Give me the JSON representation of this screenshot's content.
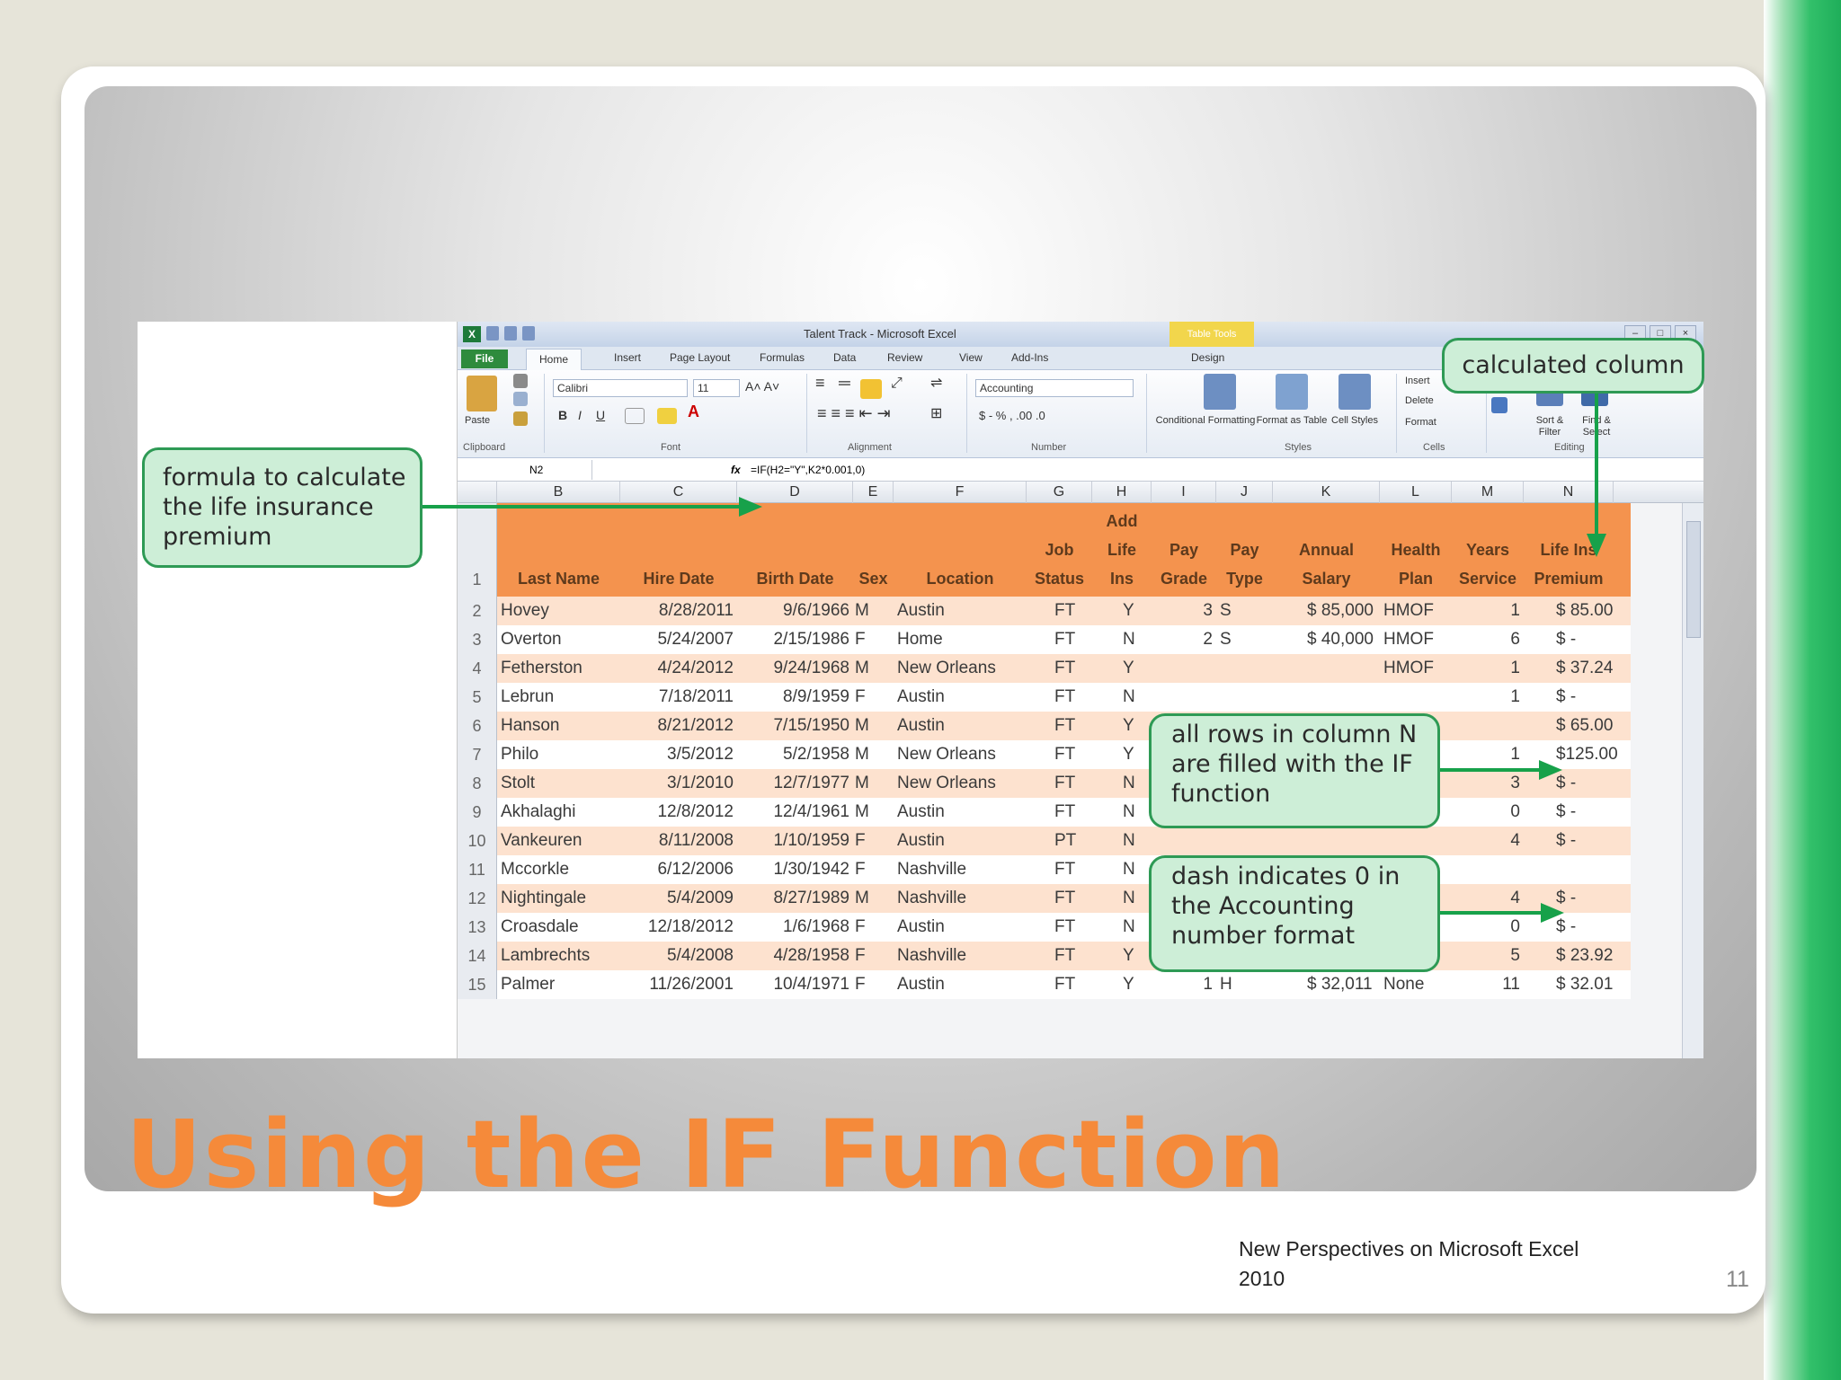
{
  "slide": {
    "title": "Using the IF Function",
    "footer": "New Perspectives on Microsoft Excel 2010",
    "page_number": "11"
  },
  "excel": {
    "window_title": "Talent Track - Microsoft Excel",
    "context_tab_header": "Table Tools",
    "tabs": [
      "File",
      "Home",
      "Insert",
      "Page Layout",
      "Formulas",
      "Data",
      "Review",
      "View",
      "Add-Ins",
      "Design"
    ],
    "ribbon": {
      "paste_label": "Paste",
      "font_name": "Calibri",
      "font_size": "11",
      "number_format": "Accounting",
      "conditional_formatting": "Conditional Formatting",
      "format_as_table": "Format as Table",
      "cell_styles": "Cell Styles",
      "insert": "Insert",
      "delete": "Delete",
      "format": "Format",
      "sort_filter": "Sort & Filter",
      "find_select": "Find & Select",
      "group_labels": [
        "Clipboard",
        "Font",
        "Alignment",
        "Number",
        "Styles",
        "Cells",
        "Editing"
      ]
    },
    "name_box": "N2",
    "fx_label": "fx",
    "formula": "=IF(H2=\"Y\",K2*0.001,0)",
    "column_letters": [
      "B",
      "C",
      "D",
      "E",
      "F",
      "G",
      "H",
      "I",
      "J",
      "K",
      "L",
      "M",
      "N"
    ],
    "header_row": {
      "row_number": "1",
      "cells": [
        {
          "top": "",
          "mid": "",
          "bottom": "Last Name"
        },
        {
          "top": "",
          "mid": "",
          "bottom": "Hire Date"
        },
        {
          "top": "",
          "mid": "",
          "bottom": "Birth Date"
        },
        {
          "top": "",
          "mid": "",
          "bottom": "Sex"
        },
        {
          "top": "",
          "mid": "",
          "bottom": "Location"
        },
        {
          "top": "",
          "mid": "Job",
          "bottom": "Status"
        },
        {
          "top": "Add",
          "mid": "Life",
          "bottom": "Ins"
        },
        {
          "top": "",
          "mid": "Pay",
          "bottom": "Grade"
        },
        {
          "top": "",
          "mid": "Pay",
          "bottom": "Type"
        },
        {
          "top": "",
          "mid": "Annual",
          "bottom": "Salary"
        },
        {
          "top": "",
          "mid": "Health",
          "bottom": "Plan"
        },
        {
          "top": "",
          "mid": "Years",
          "bottom": "Service"
        },
        {
          "top": "",
          "mid": "Life Ins",
          "bottom": "Premium"
        }
      ]
    },
    "rows": [
      {
        "n": "2",
        "name": "Hovey",
        "hire": "8/28/2011",
        "birth": "9/6/1966",
        "sex": "M",
        "loc": "Austin",
        "status": "FT",
        "ins": "Y",
        "grade": "3",
        "type": "S",
        "salary": "$  85,000",
        "plan": "HMOF",
        "years": "1",
        "premium": "$  85.00"
      },
      {
        "n": "3",
        "name": "Overton",
        "hire": "5/24/2007",
        "birth": "2/15/1986",
        "sex": "F",
        "loc": "Home",
        "status": "FT",
        "ins": "N",
        "grade": "2",
        "type": "S",
        "salary": "$  40,000",
        "plan": "HMOF",
        "years": "6",
        "premium": "$     -"
      },
      {
        "n": "4",
        "name": "Fetherston",
        "hire": "4/24/2012",
        "birth": "9/24/1968",
        "sex": "M",
        "loc": "New Orleans",
        "status": "FT",
        "ins": "Y",
        "grade": "",
        "type": "",
        "salary": "",
        "plan": "HMOF",
        "years": "1",
        "premium": "$  37.24"
      },
      {
        "n": "5",
        "name": "Lebrun",
        "hire": "7/18/2011",
        "birth": "8/9/1959",
        "sex": "F",
        "loc": "Austin",
        "status": "FT",
        "ins": "N",
        "grade": "",
        "type": "",
        "salary": "",
        "plan": "",
        "years": "1",
        "premium": "$     -"
      },
      {
        "n": "6",
        "name": "Hanson",
        "hire": "8/21/2012",
        "birth": "7/15/1950",
        "sex": "M",
        "loc": "Austin",
        "status": "FT",
        "ins": "Y",
        "grade": "",
        "type": "",
        "salary": "",
        "plan": "",
        "years": "",
        "premium": "$  65.00"
      },
      {
        "n": "7",
        "name": "Philo",
        "hire": "3/5/2012",
        "birth": "5/2/1958",
        "sex": "M",
        "loc": "New Orleans",
        "status": "FT",
        "ins": "Y",
        "grade": "",
        "type": "",
        "salary": "",
        "plan": "",
        "years": "1",
        "premium": "$125.00"
      },
      {
        "n": "8",
        "name": "Stolt",
        "hire": "3/1/2010",
        "birth": "12/7/1977",
        "sex": "M",
        "loc": "New Orleans",
        "status": "FT",
        "ins": "N",
        "grade": "",
        "type": "",
        "salary": "",
        "plan": "",
        "years": "3",
        "premium": "$     -"
      },
      {
        "n": "9",
        "name": "Akhalaghi",
        "hire": "12/8/2012",
        "birth": "12/4/1961",
        "sex": "M",
        "loc": "Austin",
        "status": "FT",
        "ins": "N",
        "grade": "",
        "type": "",
        "salary": "",
        "plan": "",
        "years": "0",
        "premium": "$     -"
      },
      {
        "n": "10",
        "name": "Vankeuren",
        "hire": "8/11/2008",
        "birth": "1/10/1959",
        "sex": "F",
        "loc": "Austin",
        "status": "PT",
        "ins": "N",
        "grade": "",
        "type": "",
        "salary": "",
        "plan": "",
        "years": "4",
        "premium": "$     -"
      },
      {
        "n": "11",
        "name": "Mccorkle",
        "hire": "6/12/2006",
        "birth": "1/30/1942",
        "sex": "F",
        "loc": "Nashville",
        "status": "FT",
        "ins": "N",
        "grade": "",
        "type": "",
        "salary": "",
        "plan": "",
        "years": "",
        "premium": ""
      },
      {
        "n": "12",
        "name": "Nightingale",
        "hire": "5/4/2009",
        "birth": "8/27/1989",
        "sex": "M",
        "loc": "Nashville",
        "status": "FT",
        "ins": "N",
        "grade": "",
        "type": "",
        "salary": "",
        "plan": "",
        "years": "4",
        "premium": "$     -"
      },
      {
        "n": "13",
        "name": "Croasdale",
        "hire": "12/18/2012",
        "birth": "1/6/1968",
        "sex": "F",
        "loc": "Austin",
        "status": "FT",
        "ins": "N",
        "grade": "",
        "type": "",
        "salary": "",
        "plan": "",
        "years": "0",
        "premium": "$     -"
      },
      {
        "n": "14",
        "name": "Lambrechts",
        "hire": "5/4/2008",
        "birth": "4/28/1958",
        "sex": "F",
        "loc": "Nashville",
        "status": "FT",
        "ins": "Y",
        "grade": "1",
        "type": "H",
        "salary": "$  23,920",
        "plan": "HMOF",
        "years": "5",
        "premium": "$  23.92"
      },
      {
        "n": "15",
        "name": "Palmer",
        "hire": "11/26/2001",
        "birth": "10/4/1971",
        "sex": "F",
        "loc": "Austin",
        "status": "FT",
        "ins": "Y",
        "grade": "1",
        "type": "H",
        "salary": "$  32,011",
        "plan": "None",
        "years": "11",
        "premium": "$  32.01"
      }
    ]
  },
  "callouts": {
    "formula": "formula to calculate the life insurance premium",
    "calculated_column": "calculated column",
    "all_rows": "all rows in column N are filled with the IF function",
    "dash": "dash indicates 0 in the Accounting number format"
  },
  "colors": {
    "title": "#f58a3a",
    "table_header": "#f4934e",
    "band_row": "#fde2cf",
    "callout_fill": "#cdeed7",
    "callout_border": "#2e9a55",
    "arrow": "#17a14a"
  }
}
